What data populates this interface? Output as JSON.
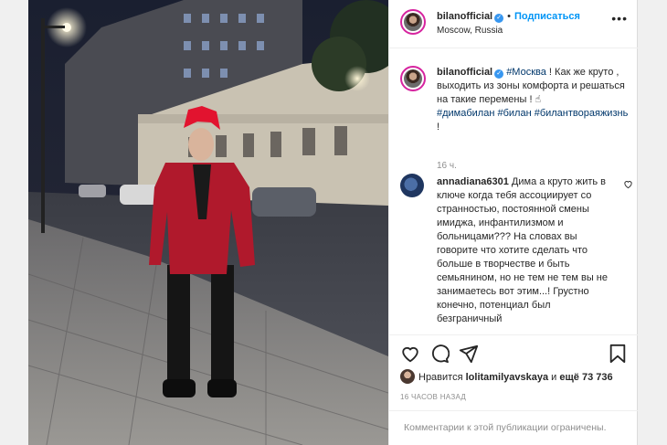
{
  "header": {
    "username": "bilanofficial",
    "follow_label": "Подписаться",
    "location": "Moscow, Russia",
    "more_icon": "more-horizontal-icon"
  },
  "caption": {
    "username": "bilanofficial",
    "hashtag1": "#Москва",
    "text": " ! Как же круто , выходить из зоны комфорта и решаться на такие перемены ! ☝",
    "hashtags": "#димабилан #билан #билантвораяжизнь",
    "suffix": " !",
    "time": "16 ч."
  },
  "comment": {
    "username": "annadiana6301",
    "text": " Дима а круто жить в ключе когда тебя ассоциирует со странностью, постоянной смены имиджа, инфантилизмом и больницами??? На словах вы говорите что хотите сделать что больше в творчестве и быть семьянином, но не тем не тем вы не занимаетесь вот этим...! Грустно конечно, потенциал был безграничный"
  },
  "actions": {
    "like_icon": "heart-icon",
    "comment_icon": "comment-icon",
    "share_icon": "share-icon",
    "save_icon": "bookmark-icon"
  },
  "likes": {
    "prefix": "Нравится ",
    "user": "lolitamilyavskaya",
    "middle": " и ",
    "more": "ещё 73 736"
  },
  "post_time": "16 ЧАСОВ НАЗАД",
  "footer_text": "Комментарии к этой публикации ограничены."
}
